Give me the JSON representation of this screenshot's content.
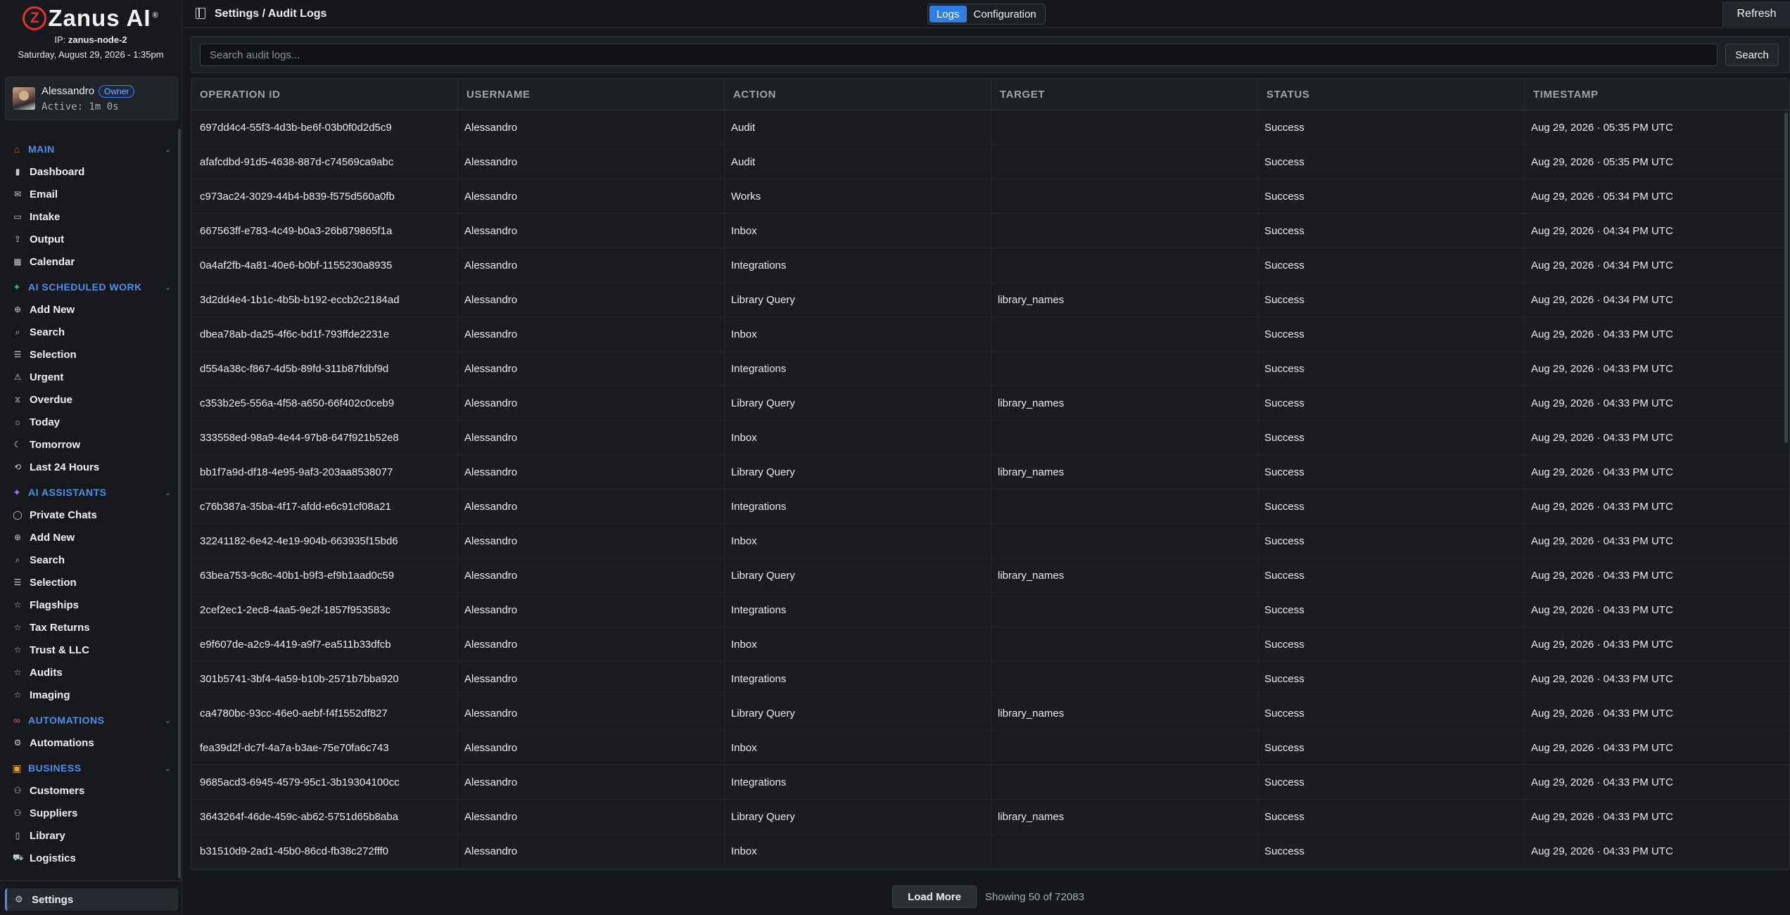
{
  "brand": {
    "logo_letter": "Z",
    "name": "Zanus AI",
    "reg": "®"
  },
  "server": {
    "ip_label": "IP:",
    "ip_value": "zanus-node-2",
    "datetime": "Saturday, August 29, 2026 - 1:35pm"
  },
  "user": {
    "name": "Alessandro",
    "role": "Owner",
    "active": "Active: 1m 0s"
  },
  "sidebar": {
    "sections": [
      {
        "label": "MAIN",
        "icon": "home-icon",
        "items": [
          {
            "label": "Dashboard",
            "icon": "bar-chart-icon"
          },
          {
            "label": "Email",
            "icon": "mail-icon"
          },
          {
            "label": "Intake",
            "icon": "inbox-icon"
          },
          {
            "label": "Output",
            "icon": "output-icon"
          },
          {
            "label": "Calendar",
            "icon": "calendar-icon"
          }
        ]
      },
      {
        "label": "AI SCHEDULED WORK",
        "icon": "sparkle-icon",
        "items": [
          {
            "label": "Add New",
            "icon": "plus-circle-icon"
          },
          {
            "label": "Search",
            "icon": "search-icon"
          },
          {
            "label": "Selection",
            "icon": "list-icon"
          },
          {
            "label": "Urgent",
            "icon": "warning-icon"
          },
          {
            "label": "Overdue",
            "icon": "hourglass-icon"
          },
          {
            "label": "Today",
            "icon": "sun-icon"
          },
          {
            "label": "Tomorrow",
            "icon": "moon-icon"
          },
          {
            "label": "Last 24 Hours",
            "icon": "history-icon"
          }
        ]
      },
      {
        "label": "AI ASSISTANTS",
        "icon": "sparkle-icon",
        "items": [
          {
            "label": "Private Chats",
            "icon": "chat-icon"
          },
          {
            "label": "Add New",
            "icon": "plus-circle-icon"
          },
          {
            "label": "Search",
            "icon": "search-icon"
          },
          {
            "label": "Selection",
            "icon": "list-icon"
          },
          {
            "label": "Flagships",
            "icon": "star-icon"
          },
          {
            "label": "Tax Returns",
            "icon": "star-icon"
          },
          {
            "label": "Trust & LLC",
            "icon": "star-icon"
          },
          {
            "label": "Audits",
            "icon": "star-icon"
          },
          {
            "label": "Imaging",
            "icon": "star-icon"
          }
        ]
      },
      {
        "label": "AUTOMATIONS",
        "icon": "link-icon",
        "items": [
          {
            "label": "Automations",
            "icon": "workflow-icon"
          }
        ]
      },
      {
        "label": "BUSINESS",
        "icon": "briefcase-icon",
        "items": [
          {
            "label": "Customers",
            "icon": "users-icon"
          },
          {
            "label": "Suppliers",
            "icon": "users-icon"
          },
          {
            "label": "Library",
            "icon": "book-icon"
          },
          {
            "label": "Logistics",
            "icon": "truck-icon"
          }
        ]
      }
    ],
    "settings_label": "Settings"
  },
  "header": {
    "breadcrumb": "Settings / Audit Logs",
    "tabs": [
      "Logs",
      "Configuration"
    ],
    "active_tab": "Logs",
    "refresh_label": "Refresh"
  },
  "search": {
    "placeholder": "Search audit logs...",
    "value": "",
    "button_label": "Search"
  },
  "table": {
    "columns": [
      "OPERATION ID",
      "USERNAME",
      "ACTION",
      "TARGET",
      "STATUS",
      "TIMESTAMP"
    ],
    "rows": [
      [
        "697dd4c4-55f3-4d3b-be6f-03b0f0d2d5c9",
        "Alessandro",
        "Audit",
        "",
        "Success",
        "Aug 29, 2026 · 05:35 PM UTC"
      ],
      [
        "afafcdbd-91d5-4638-887d-c74569ca9abc",
        "Alessandro",
        "Audit",
        "",
        "Success",
        "Aug 29, 2026 · 05:35 PM UTC"
      ],
      [
        "c973ac24-3029-44b4-b839-f575d560a0fb",
        "Alessandro",
        "Works",
        "",
        "Success",
        "Aug 29, 2026 · 05:34 PM UTC"
      ],
      [
        "667563ff-e783-4c49-b0a3-26b879865f1a",
        "Alessandro",
        "Inbox",
        "",
        "Success",
        "Aug 29, 2026 · 04:34 PM UTC"
      ],
      [
        "0a4af2fb-4a81-40e6-b0bf-1155230a8935",
        "Alessandro",
        "Integrations",
        "",
        "Success",
        "Aug 29, 2026 · 04:34 PM UTC"
      ],
      [
        "3d2dd4e4-1b1c-4b5b-b192-eccb2c2184ad",
        "Alessandro",
        "Library Query",
        "library_names",
        "Success",
        "Aug 29, 2026 · 04:34 PM UTC"
      ],
      [
        "dbea78ab-da25-4f6c-bd1f-793ffde2231e",
        "Alessandro",
        "Inbox",
        "",
        "Success",
        "Aug 29, 2026 · 04:33 PM UTC"
      ],
      [
        "d554a38c-f867-4d5b-89fd-311b87fdbf9d",
        "Alessandro",
        "Integrations",
        "",
        "Success",
        "Aug 29, 2026 · 04:33 PM UTC"
      ],
      [
        "c353b2e5-556a-4f58-a650-66f402c0ceb9",
        "Alessandro",
        "Library Query",
        "library_names",
        "Success",
        "Aug 29, 2026 · 04:33 PM UTC"
      ],
      [
        "333558ed-98a9-4e44-97b8-647f921b52e8",
        "Alessandro",
        "Inbox",
        "",
        "Success",
        "Aug 29, 2026 · 04:33 PM UTC"
      ],
      [
        "bb1f7a9d-df18-4e95-9af3-203aa8538077",
        "Alessandro",
        "Library Query",
        "library_names",
        "Success",
        "Aug 29, 2026 · 04:33 PM UTC"
      ],
      [
        "c76b387a-35ba-4f17-afdd-e6c91cf08a21",
        "Alessandro",
        "Integrations",
        "",
        "Success",
        "Aug 29, 2026 · 04:33 PM UTC"
      ],
      [
        "32241182-6e42-4e19-904b-663935f15bd6",
        "Alessandro",
        "Inbox",
        "",
        "Success",
        "Aug 29, 2026 · 04:33 PM UTC"
      ],
      [
        "63bea753-9c8c-40b1-b9f3-ef9b1aad0c59",
        "Alessandro",
        "Library Query",
        "library_names",
        "Success",
        "Aug 29, 2026 · 04:33 PM UTC"
      ],
      [
        "2cef2ec1-2ec8-4aa5-9e2f-1857f953583c",
        "Alessandro",
        "Integrations",
        "",
        "Success",
        "Aug 29, 2026 · 04:33 PM UTC"
      ],
      [
        "e9f607de-a2c9-4419-a9f7-ea511b33dfcb",
        "Alessandro",
        "Inbox",
        "",
        "Success",
        "Aug 29, 2026 · 04:33 PM UTC"
      ],
      [
        "301b5741-3bf4-4a59-b10b-2571b7bba920",
        "Alessandro",
        "Integrations",
        "",
        "Success",
        "Aug 29, 2026 · 04:33 PM UTC"
      ],
      [
        "ca4780bc-93cc-46e0-aebf-f4f1552df827",
        "Alessandro",
        "Library Query",
        "library_names",
        "Success",
        "Aug 29, 2026 · 04:33 PM UTC"
      ],
      [
        "fea39d2f-dc7f-4a7a-b3ae-75e70fa6c743",
        "Alessandro",
        "Inbox",
        "",
        "Success",
        "Aug 29, 2026 · 04:33 PM UTC"
      ],
      [
        "9685acd3-6945-4579-95c1-3b19304100cc",
        "Alessandro",
        "Integrations",
        "",
        "Success",
        "Aug 29, 2026 · 04:33 PM UTC"
      ],
      [
        "3643264f-46de-459c-ab62-5751d65b8aba",
        "Alessandro",
        "Library Query",
        "library_names",
        "Success",
        "Aug 29, 2026 · 04:33 PM UTC"
      ],
      [
        "b31510d9-2ad1-45b0-86cd-fb38c272fff0",
        "Alessandro",
        "Inbox",
        "",
        "Success",
        "Aug 29, 2026 · 04:33 PM UTC"
      ]
    ]
  },
  "footer": {
    "load_more_label": "Load More",
    "showing_text": "Showing 50 of 72083"
  },
  "colors": {
    "accent": "#2f7ee8",
    "background": "#16181c",
    "brand_red": "#e2322b"
  }
}
